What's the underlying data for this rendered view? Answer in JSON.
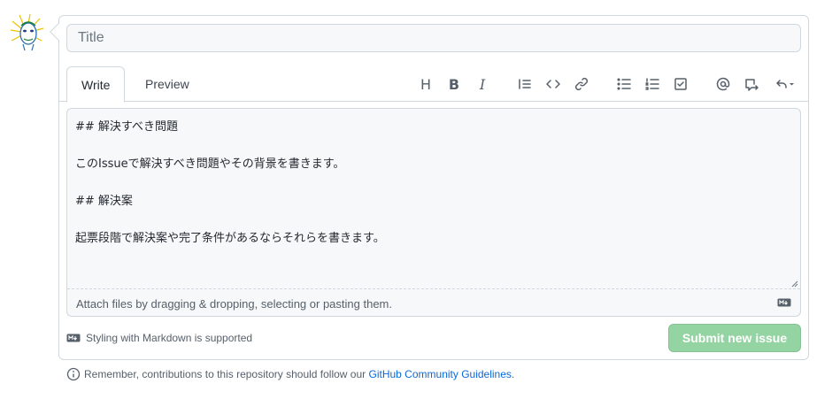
{
  "form": {
    "title_placeholder": "Title",
    "title_value": ""
  },
  "tabs": {
    "write": "Write",
    "preview": "Preview",
    "active": "write"
  },
  "toolbar": {
    "heading_glyph": "H",
    "bold_glyph": "B",
    "italic_glyph": "I",
    "icons": [
      "heading-icon",
      "bold-icon",
      "italic-icon",
      "quote-icon",
      "code-icon",
      "link-icon",
      "unordered-list-icon",
      "ordered-list-icon",
      "task-list-icon",
      "mention-icon",
      "cross-reference-icon",
      "saved-replies-icon"
    ]
  },
  "editor": {
    "content": "## 解決すべき問題\n\nこのIssueで解決すべき問題やその背景を書きます。\n\n## 解決案\n\n起票段階で解決案や完了条件があるならそれらを書きます。",
    "attach_text": "Attach files by dragging & dropping, selecting or pasting them."
  },
  "markdown_note": "Styling with Markdown is supported",
  "submit_label": "Submit new issue",
  "footer": {
    "prefix": "Remember, contributions to this repository should follow our ",
    "link_text": "GitHub Community Guidelines",
    "suffix": "."
  },
  "colors": {
    "submit_disabled": "#94d3a2",
    "link": "#0969da",
    "border": "#d0d7de",
    "field_bg": "#f6f8fa"
  }
}
